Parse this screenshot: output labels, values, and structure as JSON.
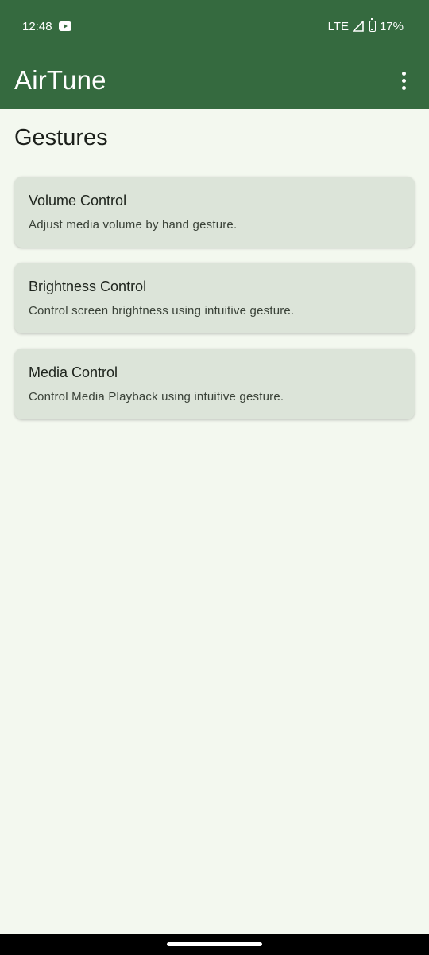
{
  "status_bar": {
    "time": "12:48",
    "network": "LTE",
    "battery": "17%",
    "icons": [
      "youtube-notification-icon",
      "signal-icon",
      "battery-icon"
    ]
  },
  "app_bar": {
    "title": "AirTune",
    "menu_icon": "more-vert-icon"
  },
  "section": {
    "title": "Gestures"
  },
  "cards": [
    {
      "title": "Volume Control",
      "description": "Adjust media volume by hand gesture."
    },
    {
      "title": "Brightness Control",
      "description": "Control screen brightness using intuitive gesture."
    },
    {
      "title": "Media Control",
      "description": "Control Media Playback using intuitive gesture."
    }
  ],
  "colors": {
    "primary": "#356a3f",
    "background": "#f3f8ef",
    "card": "#dce4d9"
  }
}
